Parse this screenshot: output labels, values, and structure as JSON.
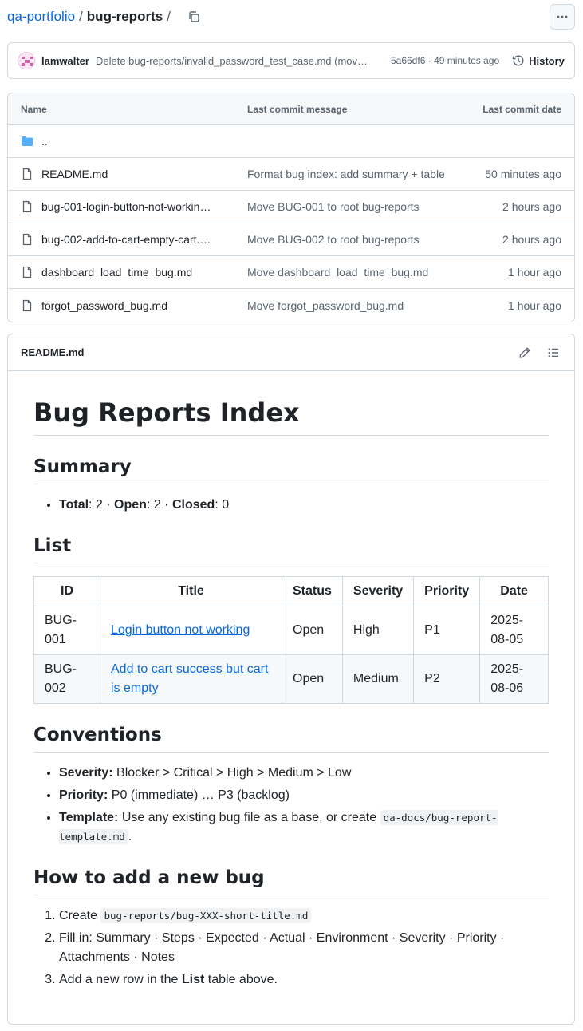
{
  "breadcrumb": {
    "repo": "qa-portfolio",
    "sep1": "/",
    "dir": "bug-reports",
    "sep2": "/"
  },
  "commit": {
    "author": "lamwalter",
    "message": "Delete bug-reports/invalid_password_test_case.md (mov…",
    "sha": "5a66df6",
    "dot": "·",
    "time": "49 minutes ago",
    "history_label": "History"
  },
  "files": {
    "headers": {
      "name": "Name",
      "message": "Last commit message",
      "date": "Last commit date"
    },
    "parent": "..",
    "rows": [
      {
        "name": "README.md",
        "message": "Format bug index: add summary + table",
        "date": "50 minutes ago"
      },
      {
        "name": "bug-001-login-button-not-workin…",
        "message": "Move BUG-001 to root bug-reports",
        "date": "2 hours ago"
      },
      {
        "name": "bug-002-add-to-cart-empty-cart.…",
        "message": "Move BUG-002 to root bug-reports",
        "date": "2 hours ago"
      },
      {
        "name": "dashboard_load_time_bug.md",
        "message": "Move dashboard_load_time_bug.md",
        "date": "1 hour ago"
      },
      {
        "name": "forgot_password_bug.md",
        "message": "Move forgot_password_bug.md",
        "date": "1 hour ago"
      }
    ]
  },
  "readme": {
    "filename": "README.md",
    "title": "Bug Reports Index",
    "summary_heading": "Summary",
    "summary": {
      "total_label": "Total",
      "total_value": ": 2 · ",
      "open_label": "Open",
      "open_value": ": 2 · ",
      "closed_label": "Closed",
      "closed_value": ": 0"
    },
    "list_heading": "List",
    "table": {
      "headers": [
        "ID",
        "Title",
        "Status",
        "Severity",
        "Priority",
        "Date"
      ],
      "rows": [
        {
          "id": "BUG-001",
          "title": "Login button not working",
          "status": "Open",
          "severity": "High",
          "priority": "P1",
          "date": "2025-08-05"
        },
        {
          "id": "BUG-002",
          "title": "Add to cart success but cart is empty",
          "status": "Open",
          "severity": "Medium",
          "priority": "P2",
          "date": "2025-08-06"
        }
      ]
    },
    "conventions_heading": "Conventions",
    "conventions": {
      "severity_label": "Severity:",
      "severity_text": " Blocker > Critical > High > Medium > Low",
      "priority_label": "Priority:",
      "priority_text": " P0 (immediate) … P3 (backlog)",
      "template_label": "Template:",
      "template_text": " Use any existing bug file as a base, or create ",
      "template_code": "qa-docs/bug-report-template.md",
      "template_end": "."
    },
    "howto_heading": "How to add a new bug",
    "howto": {
      "step1_text": "Create ",
      "step1_code": "bug-reports/bug-XXX-short-title.md",
      "step2_text": "Fill in: Summary · Steps · Expected · Actual · Environment · Severity · Priority · Attachments · Notes",
      "step3_pre": "Add a new row in the ",
      "step3_bold": "List",
      "step3_post": " table above."
    }
  },
  "colors": {
    "link": "#0969da",
    "folder": "#54aeff",
    "border": "#d1d9e0",
    "muted": "#59636e"
  },
  "icons": [
    "copy-icon",
    "kebab-icon",
    "history-icon",
    "folder-icon",
    "file-icon",
    "pencil-icon",
    "list-outline-icon"
  ]
}
